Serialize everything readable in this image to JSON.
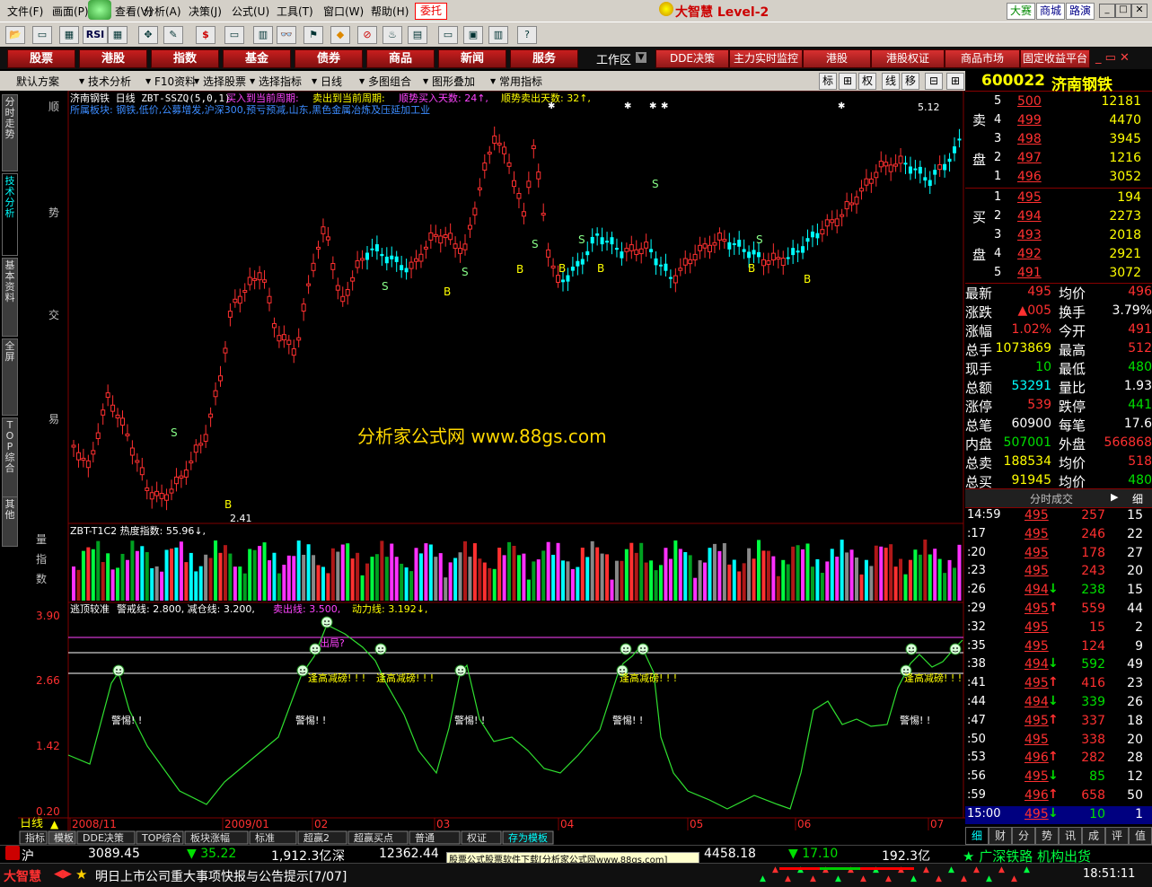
{
  "menu": {
    "items": [
      "文件(F)",
      "画面(P)",
      "查看(V)",
      "分析(A)",
      "决策(J)",
      "公式(U)",
      "工具(T)",
      "窗口(W)",
      "帮助(H)"
    ],
    "wt_label": "委托",
    "brand": "大智慧 Level-2",
    "right_tabs": [
      "大赛",
      "商城",
      "路演"
    ]
  },
  "toolbar_icons": [
    "open-icon",
    "chart-icon",
    "table-icon",
    "rsi-icon",
    "grid-icon",
    "move-icon",
    "draw-icon",
    "dollar-icon",
    "tv-icon",
    "bars-icon",
    "binoculars-icon",
    "flag-icon",
    "warning-icon",
    "stop-icon",
    "fund-icon",
    "lock-icon",
    "doc-icon",
    "window-icon",
    "book-icon",
    "help-icon"
  ],
  "rsi_label": "RSI",
  "nav": {
    "buttons": [
      "股票",
      "港股",
      "指数",
      "基金",
      "债券",
      "商品",
      "新闻",
      "服务"
    ],
    "workspace_label": "工作区",
    "right_buttons": [
      "DDE决策",
      "主力实时监控",
      "港股",
      "港股权证",
      "商品市场",
      "固定收益平台"
    ]
  },
  "toolbar2": {
    "items": [
      "默认方案",
      "技术分析",
      "F10资料",
      "选择股票",
      "选择指标",
      "日线",
      "多图组合",
      "图形叠加",
      "常用指标"
    ],
    "right_icons": [
      "标",
      "权",
      "线",
      "移"
    ]
  },
  "stock": {
    "code": "600022",
    "name": "济南钢铁"
  },
  "left_tabs": [
    "分时走势",
    "技术分析",
    "基本资料",
    "全屏",
    "TOP综合",
    "其他"
  ],
  "chart": {
    "header_line1": "济南钢铁 日线  ZBT-SSZQ(5,0,1)",
    "header_a": "买入到当前周期: ",
    "header_b": "卖出到当前周期: ",
    "header_c": "顺势买入天数: 24↑,",
    "header_d": "顺势卖出天数: 32↑,",
    "header_line2": "所属板块: 钢铁,低价,公募增发,沪深300,预亏预减,山东,黑色金属冶炼及压延加工业",
    "side_chars": [
      "顺",
      "势",
      "交",
      "易"
    ],
    "high_label": "5.12",
    "low_label": "2.41",
    "watermark": "分析家公式网 www.88gs.com",
    "vol_header": "ZBT-T1C2 热度指数: 55.96↓,",
    "vol_side": [
      "量",
      "指",
      "数"
    ],
    "ind_header_a": "逃顶较准",
    "ind_header_b": "警戒线: 2.800, 减仓线: 3.200,",
    "ind_header_c": "卖出线: 3.500,",
    "ind_header_d": "动力线: 3.192↓,",
    "ind_axis": [
      "3.90",
      "2.66",
      "1.42",
      "0.20"
    ],
    "ind_labels": {
      "out": "出局?",
      "reduce": "逢高减磅! ! !",
      "warn": "警惕! !"
    },
    "period": "日线",
    "dates": [
      "2008/11",
      "2009/01",
      "02",
      "03",
      "04",
      "05",
      "06",
      "07"
    ]
  },
  "chart_data": {
    "type": "candlestick",
    "period": "daily",
    "price_high": 5.12,
    "price_low": 2.41,
    "indicator": {
      "name": "逃顶较准",
      "warning_line": 2.8,
      "reduce_line": 3.2,
      "sell_line": 3.5,
      "power_line": 3.192,
      "axis_ticks": [
        3.9,
        2.66,
        1.42,
        0.2
      ]
    },
    "heat_index": 55.96
  },
  "quote": {
    "sell": [
      {
        "lvl": "5",
        "price": "500",
        "vol": "12181"
      },
      {
        "lvl": "4",
        "price": "499",
        "vol": "4470"
      },
      {
        "lvl": "3",
        "price": "498",
        "vol": "3945"
      },
      {
        "lvl": "2",
        "price": "497",
        "vol": "1216"
      },
      {
        "lvl": "1",
        "price": "496",
        "vol": "3052"
      }
    ],
    "buy": [
      {
        "lvl": "1",
        "price": "495",
        "vol": "194"
      },
      {
        "lvl": "2",
        "price": "494",
        "vol": "2273"
      },
      {
        "lvl": "3",
        "price": "493",
        "vol": "2018"
      },
      {
        "lvl": "4",
        "price": "492",
        "vol": "2921"
      },
      {
        "lvl": "5",
        "price": "491",
        "vol": "3072"
      }
    ],
    "sell_label": [
      "卖",
      "盘"
    ],
    "buy_label": [
      "买",
      "盘"
    ],
    "stats": [
      {
        "l1": "最新",
        "v1": "495",
        "c1": "red",
        "l2": "均价",
        "v2": "496",
        "c2": "red"
      },
      {
        "l1": "涨跌",
        "v1": "▲005",
        "c1": "red",
        "l2": "换手",
        "v2": "3.79%",
        "c2": "white"
      },
      {
        "l1": "涨幅",
        "v1": "1.02%",
        "c1": "red",
        "l2": "今开",
        "v2": "491",
        "c2": "red"
      },
      {
        "l1": "总手",
        "v1": "1073869",
        "c1": "yellow",
        "l2": "最高",
        "v2": "512",
        "c2": "red"
      },
      {
        "l1": "现手",
        "v1": "10",
        "c1": "green",
        "l2": "最低",
        "v2": "480",
        "c2": "green"
      },
      {
        "l1": "总额",
        "v1": "53291",
        "c1": "cyan",
        "l2": "量比",
        "v2": "1.93",
        "c2": "white"
      },
      {
        "l1": "涨停",
        "v1": "539",
        "c1": "red",
        "l2": "跌停",
        "v2": "441",
        "c2": "green"
      },
      {
        "l1": "总笔",
        "v1": "60900",
        "c1": "white",
        "l2": "每笔",
        "v2": "17.6",
        "c2": "white"
      },
      {
        "l1": "内盘",
        "v1": "507001",
        "c1": "green",
        "l2": "外盘",
        "v2": "566868",
        "c2": "red"
      },
      {
        "l1": "总卖",
        "v1": "188534",
        "c1": "yellow",
        "l2": "均价",
        "v2": "518",
        "c2": "red"
      },
      {
        "l1": "总买",
        "v1": "91945",
        "c1": "yellow",
        "l2": "均价",
        "v2": "480",
        "c2": "green"
      }
    ],
    "ticks_title": "分时成交",
    "ticks_btn": "细",
    "ticks": [
      {
        "t": "14:59",
        "p": "495",
        "a": "",
        "v": "257",
        "n": "15"
      },
      {
        "t": ":17",
        "p": "495",
        "a": "",
        "v": "246",
        "n": "22"
      },
      {
        "t": ":20",
        "p": "495",
        "a": "",
        "v": "178",
        "n": "27"
      },
      {
        "t": ":23",
        "p": "495",
        "a": "",
        "v": "243",
        "n": "20"
      },
      {
        "t": ":26",
        "p": "494",
        "a": "↓",
        "v": "238",
        "n": "15"
      },
      {
        "t": ":29",
        "p": "495",
        "a": "↑",
        "v": "559",
        "n": "44"
      },
      {
        "t": ":32",
        "p": "495",
        "a": "",
        "v": "15",
        "n": "2"
      },
      {
        "t": ":35",
        "p": "495",
        "a": "",
        "v": "124",
        "n": "9"
      },
      {
        "t": ":38",
        "p": "494",
        "a": "↓",
        "v": "592",
        "n": "49"
      },
      {
        "t": ":41",
        "p": "495",
        "a": "↑",
        "v": "416",
        "n": "23"
      },
      {
        "t": ":44",
        "p": "494",
        "a": "↓",
        "v": "339",
        "n": "26"
      },
      {
        "t": ":47",
        "p": "495",
        "a": "↑",
        "v": "337",
        "n": "18"
      },
      {
        "t": ":50",
        "p": "495",
        "a": "",
        "v": "338",
        "n": "20"
      },
      {
        "t": ":53",
        "p": "496",
        "a": "↑",
        "v": "282",
        "n": "28"
      },
      {
        "t": ":56",
        "p": "495",
        "a": "↓",
        "v": "85",
        "n": "12"
      },
      {
        "t": ":59",
        "p": "496",
        "a": "↑",
        "v": "658",
        "n": "50"
      },
      {
        "t": "15:00",
        "p": "495",
        "a": "↓",
        "v": "10",
        "n": "1"
      }
    ],
    "bottom_tabs": [
      "细",
      "财",
      "分",
      "势",
      "讯",
      "成",
      "评",
      "值"
    ]
  },
  "bottom_tabs": [
    "指标",
    "模板",
    "DDE决策",
    "TOP综合",
    "板块涨幅",
    "标准",
    "超赢2",
    "超赢买点",
    "普通",
    "权证",
    "存为模板"
  ],
  "index_bar": {
    "sh_label": "沪",
    "sh_val": "3089.45",
    "sh_chg": "▼ 35.22",
    "sh_amt": "1,912.3亿",
    "sz_label": "深",
    "sz_val": "12362.44",
    "mid_text": "股票公式股票软件下载[分析家公式网www.88gs.com]",
    "mid_val": "4458.18",
    "mid_chg": "▼ 17.10",
    "mid_amt": "192.3亿",
    "ticker": "★ 广深铁路 机构出货"
  },
  "status_bar": {
    "logo": "大智慧",
    "news": "明日上市公司重大事项快报与公告提示[7/07]",
    "time": "18:51:11"
  }
}
